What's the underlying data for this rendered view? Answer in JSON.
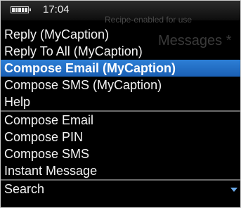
{
  "status": {
    "time": "17:04",
    "battery_icon": "battery-icon"
  },
  "background": {
    "line1": "Recipe-enabled for use",
    "line2": "Messages *"
  },
  "menu": {
    "items": [
      {
        "label": "Reply (MyCaption)"
      },
      {
        "label": "Reply To All (MyCaption)"
      },
      {
        "label": "Compose Email (MyCaption)",
        "selected": true
      },
      {
        "label": "Compose SMS (MyCaption)"
      },
      {
        "label": "Help"
      },
      {
        "label": "Compose Email"
      },
      {
        "label": "Compose PIN"
      },
      {
        "label": "Compose SMS"
      },
      {
        "label": "Instant Message"
      },
      {
        "label": "Search"
      }
    ],
    "scroll_icon": "scroll-down-icon",
    "colors": {
      "selected": "#1f6cc4",
      "separator": "#6a6a6a"
    }
  }
}
